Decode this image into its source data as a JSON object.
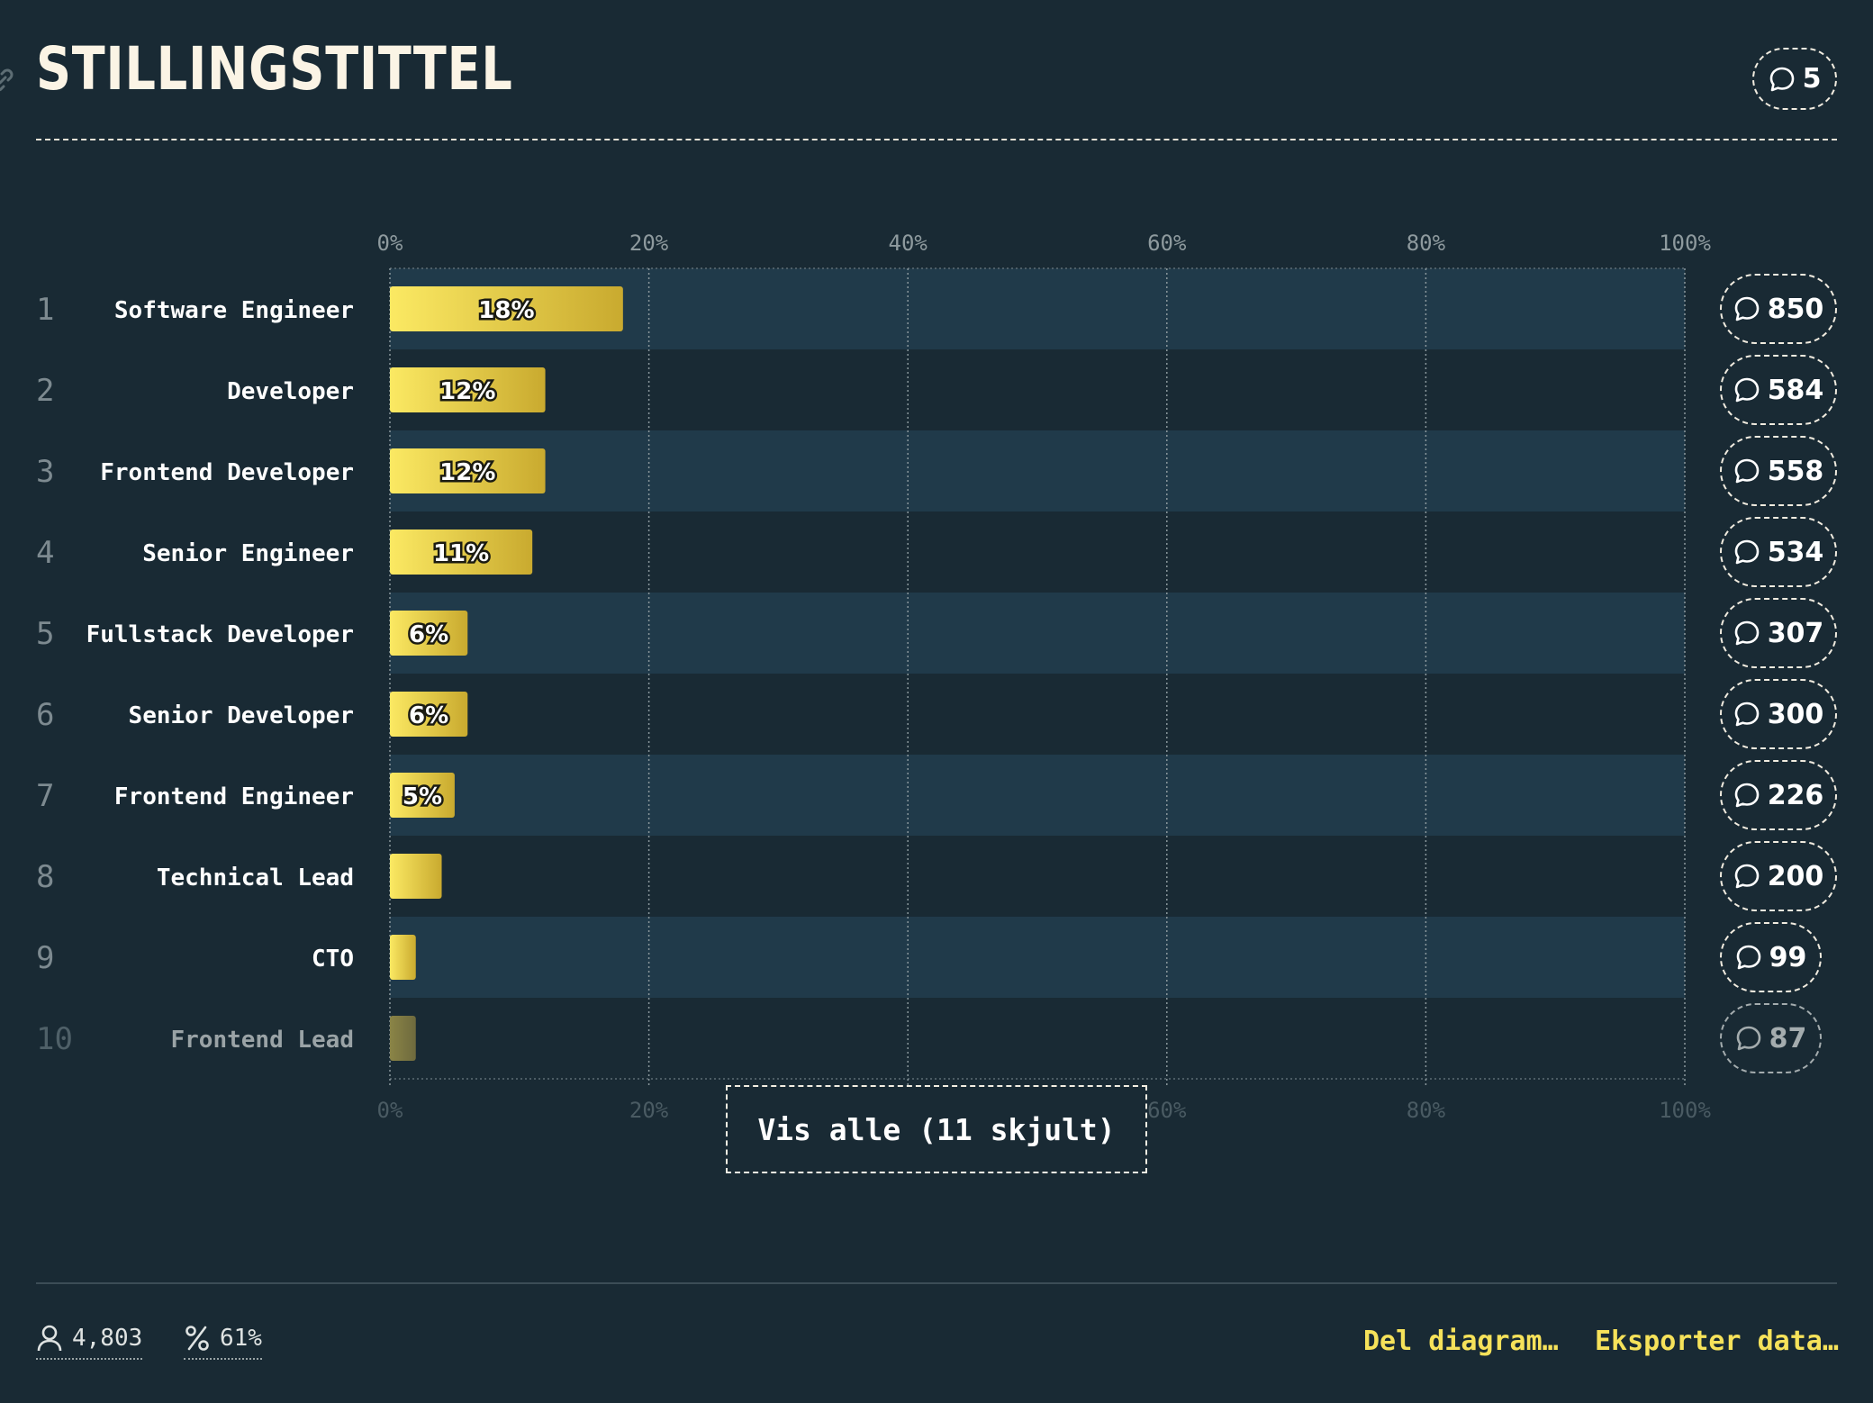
{
  "title": "STILLINGSTITTEL",
  "header_comments": "5",
  "show_all_label": "Vis alle (11 skjult)",
  "footer": {
    "respondents": "4,803",
    "percent": "61%",
    "share_label": "Del diagram…",
    "export_label": "Eksporter data…"
  },
  "colors": {
    "background": "#192a34",
    "stripe": "#203a4a",
    "bar_start": "#fbe963",
    "bar_end": "#c9aa2f",
    "text": "#f5f1e6",
    "accent": "#f6e25a"
  },
  "icons": {
    "header": "comment-icon",
    "row_count": "comment-icon",
    "respondents": "person-icon",
    "percent": "percent-icon",
    "title_link": "link-icon"
  },
  "chart_data": {
    "type": "bar",
    "orientation": "horizontal",
    "axis_ticks": [
      "0%",
      "20%",
      "40%",
      "60%",
      "80%",
      "100%"
    ],
    "xlim": [
      0,
      100
    ],
    "grid": true,
    "categories": [
      "Software Engineer",
      "Developer",
      "Frontend Developer",
      "Senior Engineer",
      "Fullstack Developer",
      "Senior Developer",
      "Frontend Engineer",
      "Technical Lead",
      "CTO",
      "Frontend Lead"
    ],
    "ranks": [
      "1",
      "2",
      "3",
      "4",
      "5",
      "6",
      "7",
      "8",
      "9",
      "10"
    ],
    "values": [
      18,
      12,
      12,
      11,
      6,
      6,
      5,
      4,
      2,
      2
    ],
    "data_labels": [
      "18%",
      "12%",
      "12%",
      "11%",
      "6%",
      "6%",
      "5%",
      "",
      "",
      ""
    ],
    "counts": [
      "850",
      "584",
      "558",
      "534",
      "307",
      "300",
      "226",
      "200",
      "99",
      "87"
    ]
  }
}
